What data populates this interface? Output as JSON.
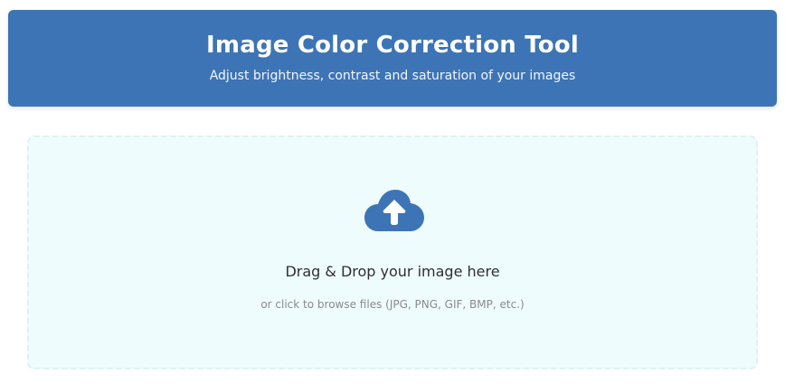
{
  "header": {
    "title": "Image Color Correction Tool",
    "subtitle": "Adjust brightness, contrast and saturation of your images"
  },
  "dropzone": {
    "icon": "cloud-upload-icon",
    "title": "Drag & Drop your image here",
    "hint": "or click to browse files (JPG, PNG, GIF, BMP, etc.)"
  },
  "colors": {
    "brand": "#3d74b5",
    "dropzone_background": "#effcfd",
    "dropzone_border": "#dff1f4"
  }
}
